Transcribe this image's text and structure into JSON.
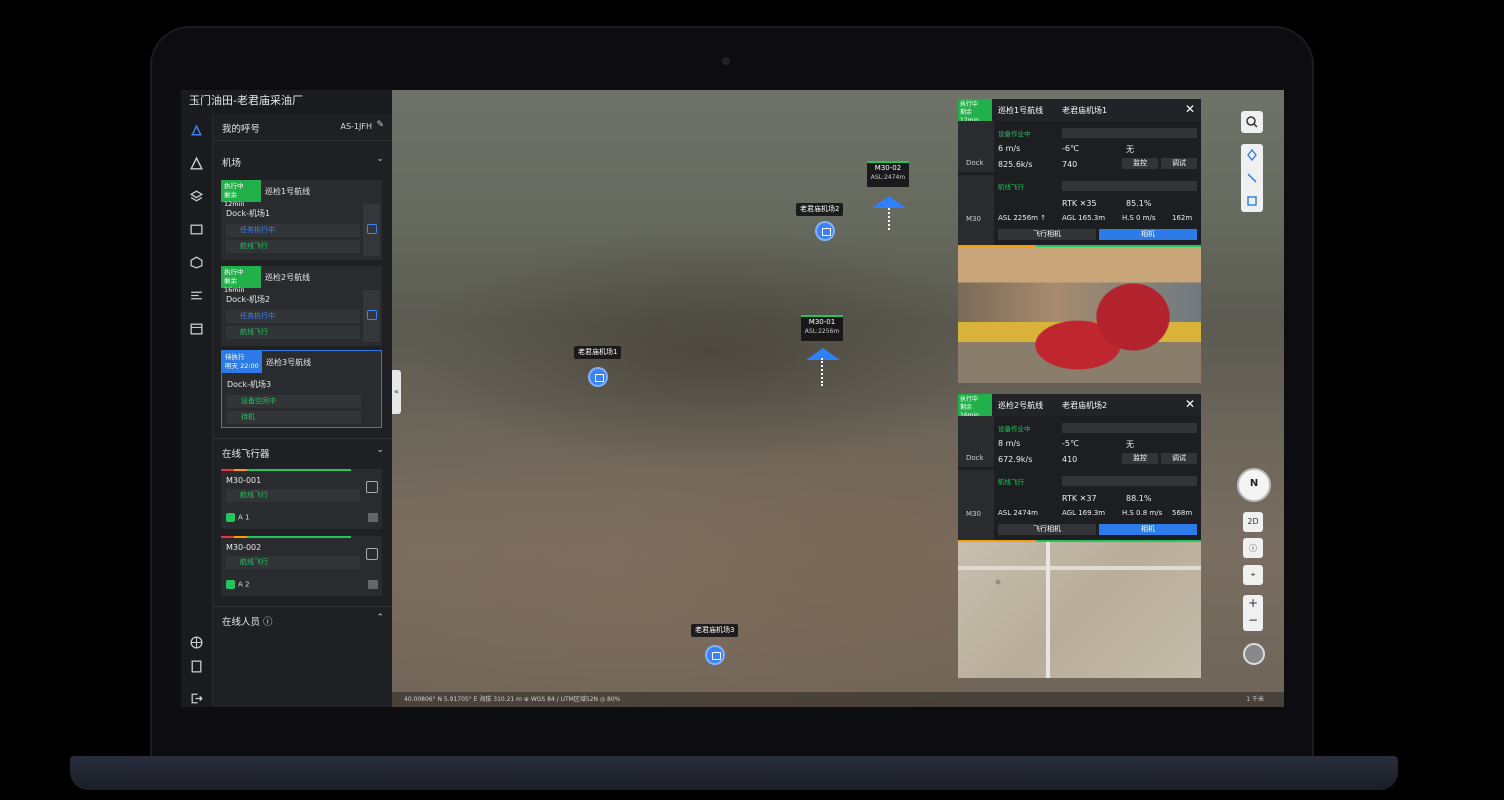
{
  "app_title": "玉门油田-老君庙采油厂",
  "callsign": {
    "label": "我的呼号",
    "value": "AS-1JFH"
  },
  "airports_section": {
    "title": "机场",
    "tasks": [
      {
        "badge": "执行中",
        "badge_sub": "剩余 12min",
        "route": "巡检1号航线",
        "dock": "Dock-机场1",
        "status1": "任务执行中",
        "status2": "航线飞行"
      },
      {
        "badge": "执行中",
        "badge_sub": "剩余 16min",
        "route": "巡检2号航线",
        "dock": "Dock-机场2",
        "status1": "任务执行中",
        "status2": "航线飞行"
      },
      {
        "badge": "待执行",
        "badge_sub": "明天 22:00",
        "route": "巡检3号航线",
        "dock": "Dock-机场3",
        "status1": "设备空闲中",
        "status2": "待机"
      }
    ]
  },
  "drones_section": {
    "title": "在线飞行器",
    "drones": [
      {
        "name": "M30-001",
        "status": "航线飞行",
        "pilot": "A 1"
      },
      {
        "name": "M30-002",
        "status": "航线飞行",
        "pilot": "A 2"
      }
    ]
  },
  "people_section": {
    "title": "在线人员"
  },
  "map": {
    "docks": [
      {
        "label": "老君庙机场1"
      },
      {
        "label": "老君庙机场2"
      },
      {
        "label": "老君庙机场3"
      }
    ],
    "drones": [
      {
        "name": "M30-01",
        "asl": "ASL:2256m"
      },
      {
        "name": "M30-02",
        "asl": "ASL:2474m"
      }
    ],
    "status_left": "40.00806° N    5.91705° E    海拔  310.21 m    ⊕ WGS 84 / UTM区域52N    ◎ 80%",
    "scale": "1 千米",
    "view_toggle": "2D"
  },
  "cards": [
    {
      "badge": "执行中",
      "badge_sub": "剩余 12min",
      "route": "巡检1号航线",
      "dock": "老君庙机场1",
      "dock_label": "Dock",
      "dock_status": "设备作业中",
      "wind": "6 m/s",
      "temp": "-6℃",
      "rain": "无",
      "network": "825.6k/s",
      "storage": "740",
      "monitor": "监控",
      "debug": "调试",
      "drone_label": "M30",
      "drone_status": "航线飞行",
      "rtk": "RTK ✕35",
      "battery": "85.1%",
      "asl": "ASL  2256m ↑",
      "agl": "AGL  165.3m",
      "hspeed": "H.S 0 m/s",
      "dist": "162m",
      "btn_fly_cam": "飞行相机",
      "btn_cam": "相机"
    },
    {
      "badge": "执行中",
      "badge_sub": "剩余 16min",
      "route": "巡检2号航线",
      "dock": "老君庙机场2",
      "dock_label": "Dock",
      "dock_status": "设备作业中",
      "wind": "8 m/s",
      "temp": "-5℃",
      "rain": "无",
      "network": "672.9k/s",
      "storage": "410",
      "monitor": "监控",
      "debug": "调试",
      "drone_label": "M30",
      "drone_status": "航线飞行",
      "rtk": "RTK ✕37",
      "battery": "88.1%",
      "asl": "ASL  2474m",
      "agl": "AGL  169.3m",
      "hspeed": "H.S 0.8 m/s",
      "dist": "568m",
      "btn_fly_cam": "飞行相机",
      "btn_cam": "相机"
    }
  ],
  "colors": {
    "accent_blue": "#2d7be8",
    "status_green": "#22b04a"
  }
}
